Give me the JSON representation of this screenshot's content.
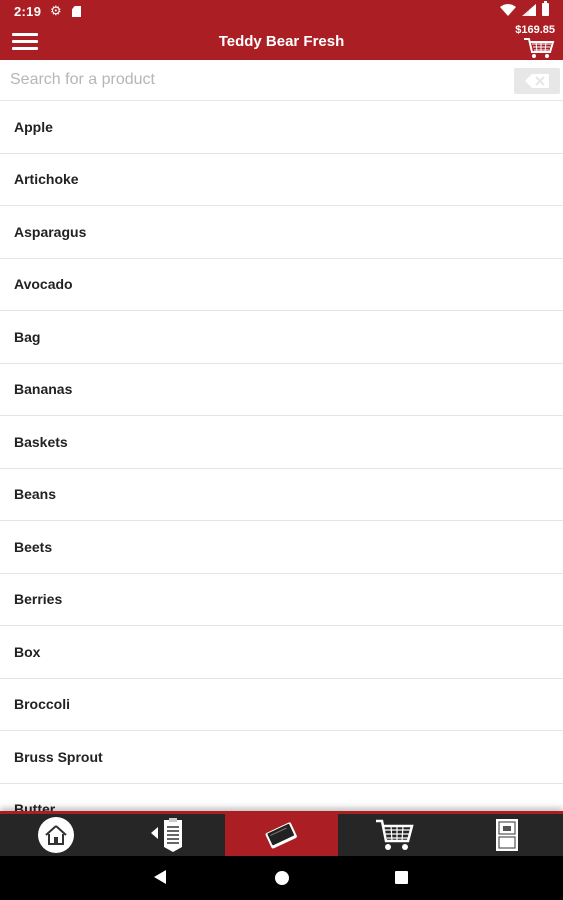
{
  "status_bar": {
    "time": "2:19",
    "icons": [
      "gear-icon",
      "sd-card-icon",
      "wifi-icon",
      "signal-icon",
      "battery-icon"
    ]
  },
  "app_bar": {
    "title": "Teddy Bear Fresh",
    "cart_total": "$169.85",
    "menu_icon": "hamburger-menu-icon",
    "cart_icon": "shopping-cart-icon"
  },
  "search": {
    "placeholder": "Search for a product",
    "value": "",
    "clear_icon": "backspace-clear-icon"
  },
  "products": [
    "Apple",
    "Artichoke",
    "Asparagus",
    "Avocado",
    "Bag",
    "Bananas",
    "Baskets",
    "Beans",
    "Beets",
    "Berries",
    "Box",
    "Broccoli",
    "Bruss Sprout",
    "Butter"
  ],
  "tabs": [
    {
      "icon": "home-icon",
      "active": false
    },
    {
      "icon": "order-list-icon",
      "active": false
    },
    {
      "icon": "catalog-book-icon",
      "active": true
    },
    {
      "icon": "cart-icon",
      "active": false
    },
    {
      "icon": "account-door-icon",
      "active": false
    }
  ],
  "colors": {
    "brand_red": "#ab1f24",
    "tab_bar_bg": "#262626",
    "text": "#222222"
  }
}
